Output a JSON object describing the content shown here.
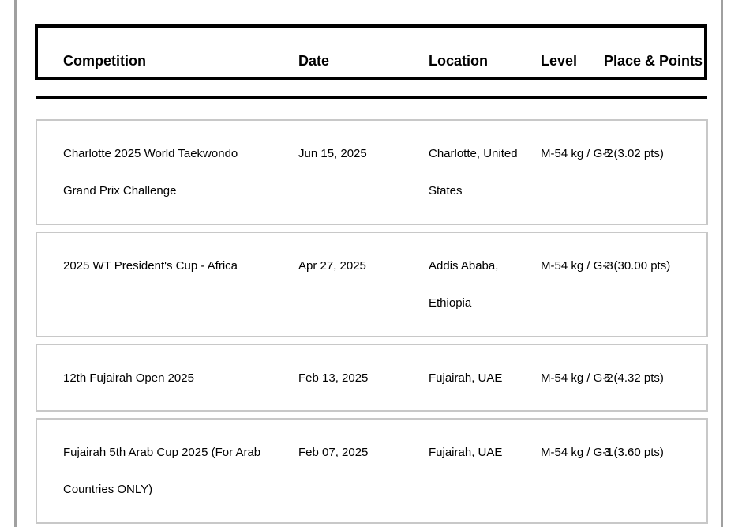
{
  "table": {
    "headers": {
      "competition": "Competition",
      "date": "Date",
      "location": "Location",
      "level": "Level",
      "place_points": "Place & Points"
    },
    "rows": [
      {
        "competition": "Charlotte 2025 World Taekwondo Grand Prix Challenge",
        "date": "Jun 15, 2025",
        "location": "Charlotte, United States",
        "level": "M-54 kg / G-2",
        "place_points": "5 (3.02 pts)"
      },
      {
        "competition": "2025 WT President's Cup - Africa",
        "date": "Apr 27, 2025",
        "location": "Addis Ababa, Ethiopia",
        "level": "M-54 kg / G-3",
        "place_points": "2 (30.00 pts)"
      },
      {
        "competition": "12th Fujairah Open 2025",
        "date": "Feb 13, 2025",
        "location": "Fujairah, UAE",
        "level": "M-54 kg / G-2",
        "place_points": "5 (4.32 pts)"
      },
      {
        "competition": "Fujairah 5th Arab Cup 2025 (For Arab Countries ONLY)",
        "date": "Feb 07, 2025",
        "location": "Fujairah, UAE",
        "level": "M-54 kg / G-1",
        "place_points": "3 (3.60 pts)"
      }
    ]
  }
}
